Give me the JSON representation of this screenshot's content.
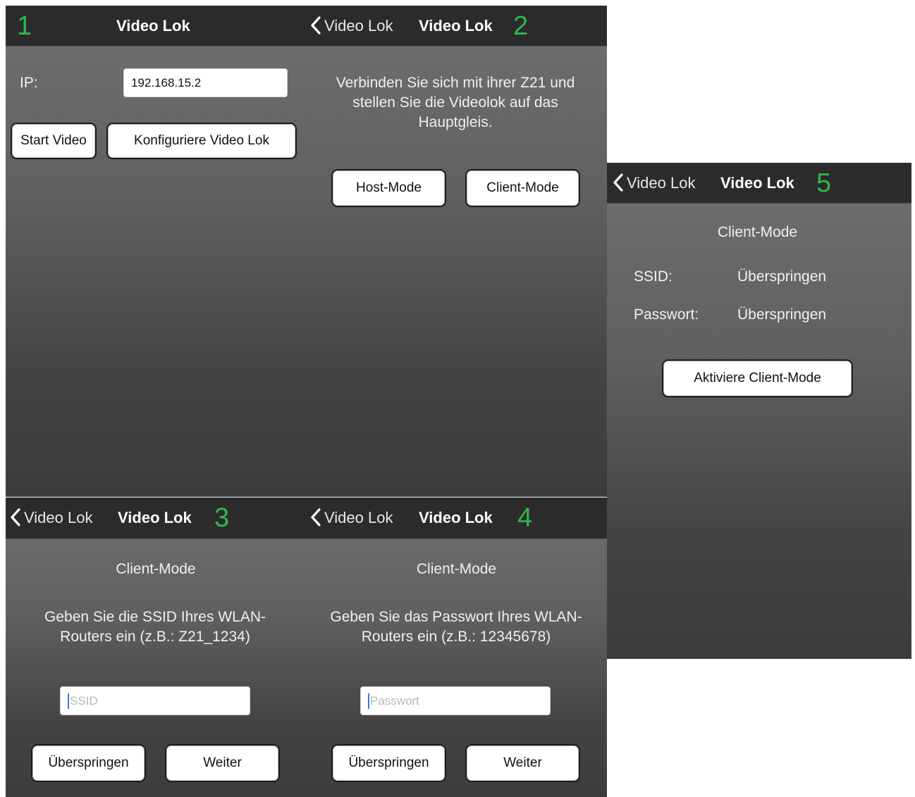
{
  "screens": [
    {
      "step": "1",
      "title": "Video Lok",
      "ip_label": "IP:",
      "ip_value": "192.168.15.2",
      "start_button": "Start Video",
      "config_button": "Konfiguriere Video Lok"
    },
    {
      "step": "2",
      "back_label": "Video Lok",
      "title": "Video Lok",
      "instruction": "Verbinden Sie sich mit ihrer Z21 und stellen Sie die Videolok auf das Hauptgleis.",
      "host_button": "Host-Mode",
      "client_button": "Client-Mode"
    },
    {
      "step": "3",
      "back_label": "Video Lok",
      "title": "Video Lok",
      "heading": "Client-Mode",
      "instruction": "Geben Sie die SSID Ihres WLAN-Routers ein (z.B.: Z21_1234)",
      "input_placeholder": "SSID",
      "skip_button": "Überspringen",
      "next_button": "Weiter"
    },
    {
      "step": "4",
      "back_label": "Video Lok",
      "title": "Video Lok",
      "heading": "Client-Mode",
      "instruction": "Geben Sie das Passwort Ihres WLAN-Routers ein (z.B.: 12345678)",
      "input_placeholder": "Passwort",
      "skip_button": "Überspringen",
      "next_button": "Weiter"
    },
    {
      "step": "5",
      "back_label": "Video Lok",
      "title": "Video Lok",
      "heading": "Client-Mode",
      "ssid_label": "SSID:",
      "ssid_value": "Überspringen",
      "password_label": "Passwort:",
      "password_value": "Überspringen",
      "activate_button": "Aktiviere Client-Mode"
    }
  ],
  "colors": {
    "step_number": "#2fb84a",
    "navbar": "#2b2b2b",
    "panel_top": "#707070",
    "panel_bottom": "#3c3c3c"
  },
  "icons": {
    "back": "chevron-left-icon"
  }
}
